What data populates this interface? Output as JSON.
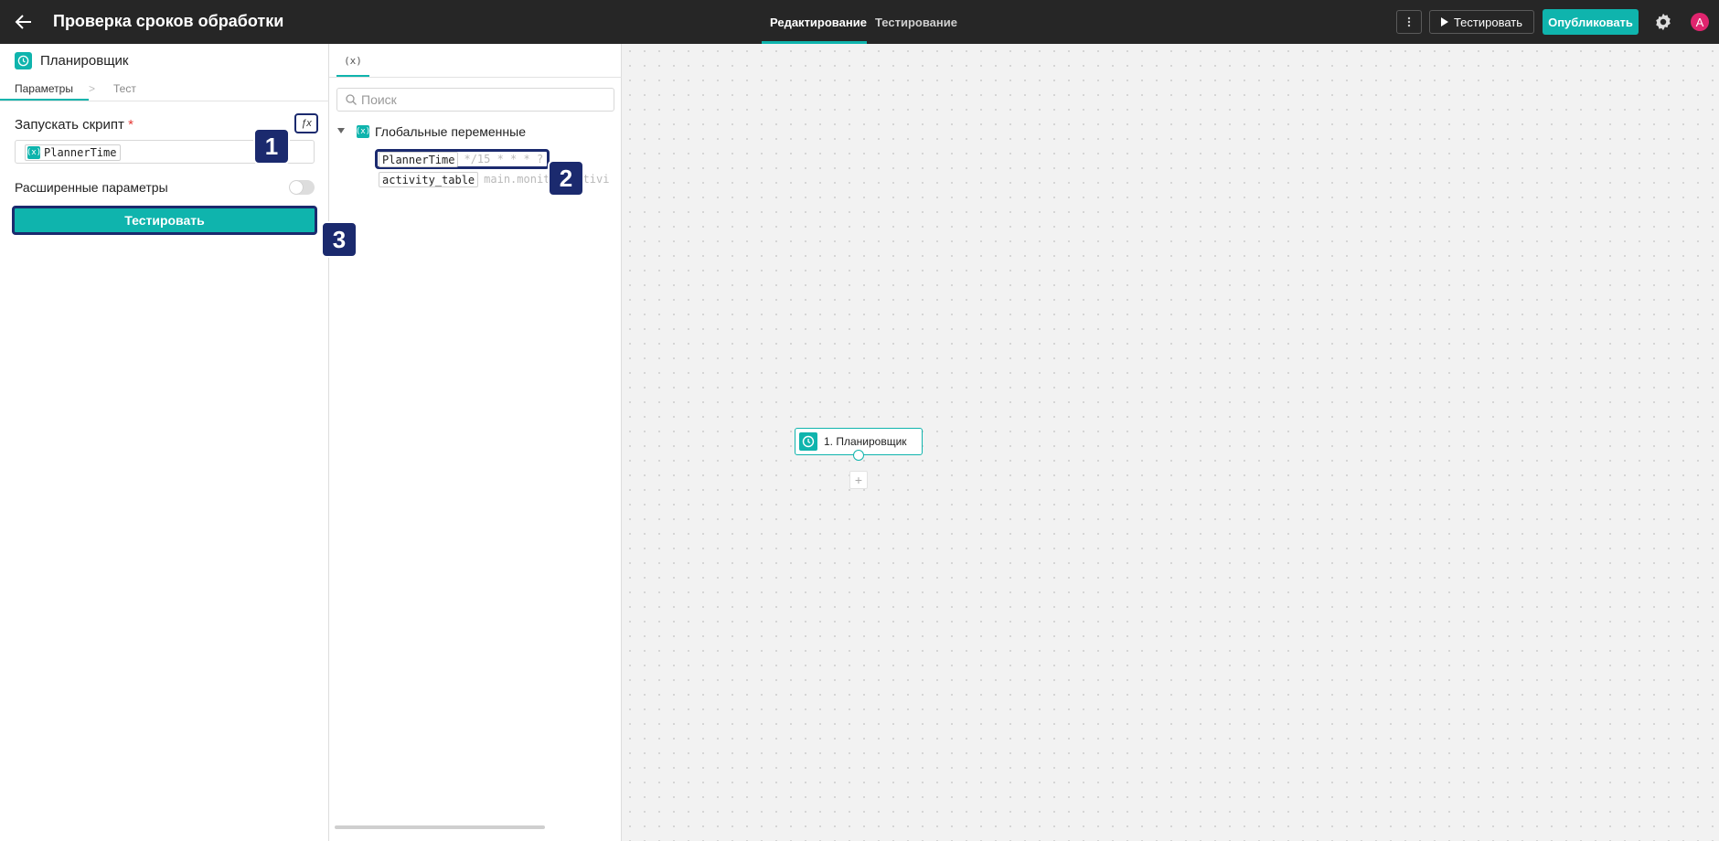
{
  "header": {
    "title": "Проверка сроков обработки",
    "tabs": [
      {
        "label": "Редактирование",
        "active": true
      },
      {
        "label": "Тестирование",
        "active": false
      }
    ],
    "test_button": "Тестировать",
    "publish_button": "Опубликовать",
    "avatar_letter": "A"
  },
  "left_panel": {
    "node_name": "Планировщик",
    "tabs": [
      {
        "label": "Параметры",
        "active": true
      },
      {
        "label": "Тест",
        "active": false
      }
    ],
    "run_script_label": "Запускать скрипт",
    "required_mark": "*",
    "fx_label": "ƒx",
    "script_value": "PlannerTime",
    "advanced_label": "Расширенные параметры",
    "advanced_enabled": false,
    "run_button": "Тестировать"
  },
  "variables_panel": {
    "tab_label": "(x)",
    "search_placeholder": "Поиск",
    "group_label": "Глобальные переменные",
    "variables": [
      {
        "name": "PlannerTime",
        "value": "*/15 * * * ?"
      },
      {
        "name": "activity_table",
        "value": "main.monitor_activi"
      }
    ]
  },
  "canvas": {
    "node_label": "1. Планировщик",
    "add_symbol": "+"
  },
  "markers": [
    "1",
    "2",
    "3"
  ],
  "colors": {
    "accent": "#0fb4ad",
    "marker": "#1b2a6e",
    "topbar": "#262626",
    "avatar": "#e0246e"
  }
}
